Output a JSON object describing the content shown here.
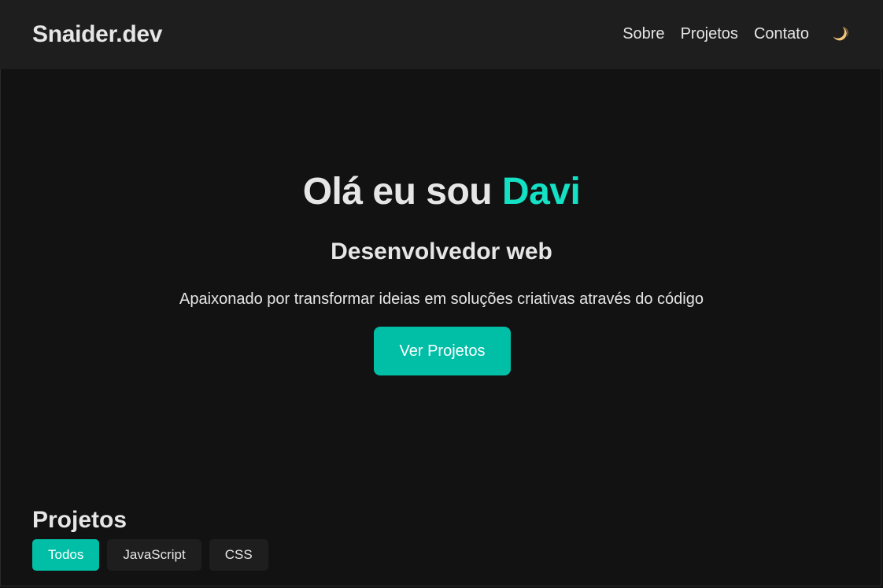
{
  "header": {
    "logo": "Snaider.dev",
    "nav": [
      {
        "label": "Sobre"
      },
      {
        "label": "Projetos"
      },
      {
        "label": "Contato"
      }
    ],
    "theme_toggle_icon": "moon-icon"
  },
  "hero": {
    "title_prefix": "Olá eu sou ",
    "title_name": "Davi",
    "subtitle": "Desenvolvedor web",
    "description": "Apaixonado por transformar ideias em soluções criativas através do código",
    "cta_label": "Ver Projetos"
  },
  "projects": {
    "title": "Projetos",
    "filters": [
      {
        "label": "Todos",
        "active": true
      },
      {
        "label": "JavaScript",
        "active": false
      },
      {
        "label": "CSS",
        "active": false
      }
    ]
  },
  "colors": {
    "accent": "#14e0c4",
    "button": "#00bfa6",
    "background": "#121212",
    "header": "#1e1e1e"
  }
}
